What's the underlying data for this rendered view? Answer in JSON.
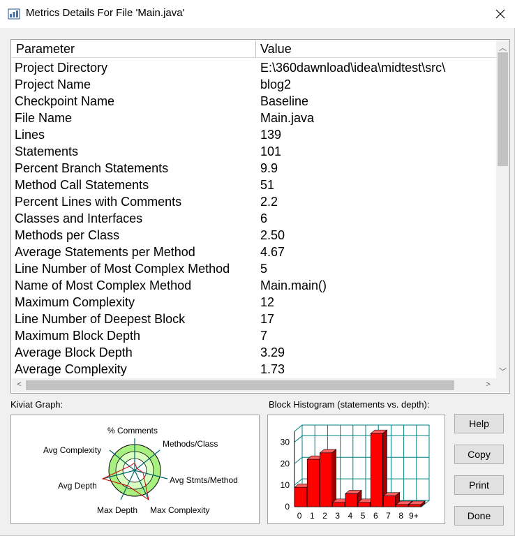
{
  "window": {
    "title": "Metrics Details For File 'Main.java'"
  },
  "table": {
    "headers": {
      "parameter": "Parameter",
      "value": "Value"
    },
    "rows": [
      {
        "param": "Project Directory",
        "value": "E:\\360dawnload\\idea\\midtest\\src\\"
      },
      {
        "param": "Project Name",
        "value": "blog2"
      },
      {
        "param": "Checkpoint Name",
        "value": "Baseline"
      },
      {
        "param": "File Name",
        "value": "Main.java"
      },
      {
        "param": "Lines",
        "value": "139"
      },
      {
        "param": "Statements",
        "value": "101"
      },
      {
        "param": "Percent Branch Statements",
        "value": "9.9"
      },
      {
        "param": "Method Call Statements",
        "value": "51"
      },
      {
        "param": "Percent Lines with Comments",
        "value": "2.2"
      },
      {
        "param": "Classes and Interfaces",
        "value": "6"
      },
      {
        "param": "Methods per Class",
        "value": "2.50"
      },
      {
        "param": "Average Statements per Method",
        "value": "4.67"
      },
      {
        "param": "Line Number of Most Complex Method",
        "value": "5"
      },
      {
        "param": "Name of Most Complex Method",
        "value": "Main.main()"
      },
      {
        "param": "Maximum Complexity",
        "value": "12"
      },
      {
        "param": "Line Number of Deepest Block",
        "value": "17"
      },
      {
        "param": "Maximum Block Depth",
        "value": "7"
      },
      {
        "param": "Average Block Depth",
        "value": "3.29"
      },
      {
        "param": "Average Complexity",
        "value": "1.73"
      }
    ]
  },
  "kiviat": {
    "label": "Kiviat Graph:",
    "axes": [
      "% Comments",
      "Methods/Class",
      "Avg Stmts/Method",
      "Max Complexity",
      "Max Depth",
      "Avg Depth",
      "Avg Complexity"
    ]
  },
  "histogram": {
    "label": "Block Histogram (statements vs. depth):"
  },
  "buttons": {
    "help": "Help",
    "copy": "Copy",
    "print": "Print",
    "done": "Done"
  },
  "chart_data": {
    "type": "bar",
    "title": "",
    "categories": [
      "0",
      "1",
      "2",
      "3",
      "4",
      "5",
      "6",
      "7",
      "8",
      "9+"
    ],
    "values": [
      9,
      22,
      25,
      2,
      6,
      2,
      34,
      5,
      1,
      1
    ],
    "ylim": [
      0,
      35
    ],
    "yticks": [
      "0",
      "10",
      "20",
      "30"
    ],
    "bar_color": "#ff0000",
    "grid_color": "#008080",
    "grid": true
  }
}
